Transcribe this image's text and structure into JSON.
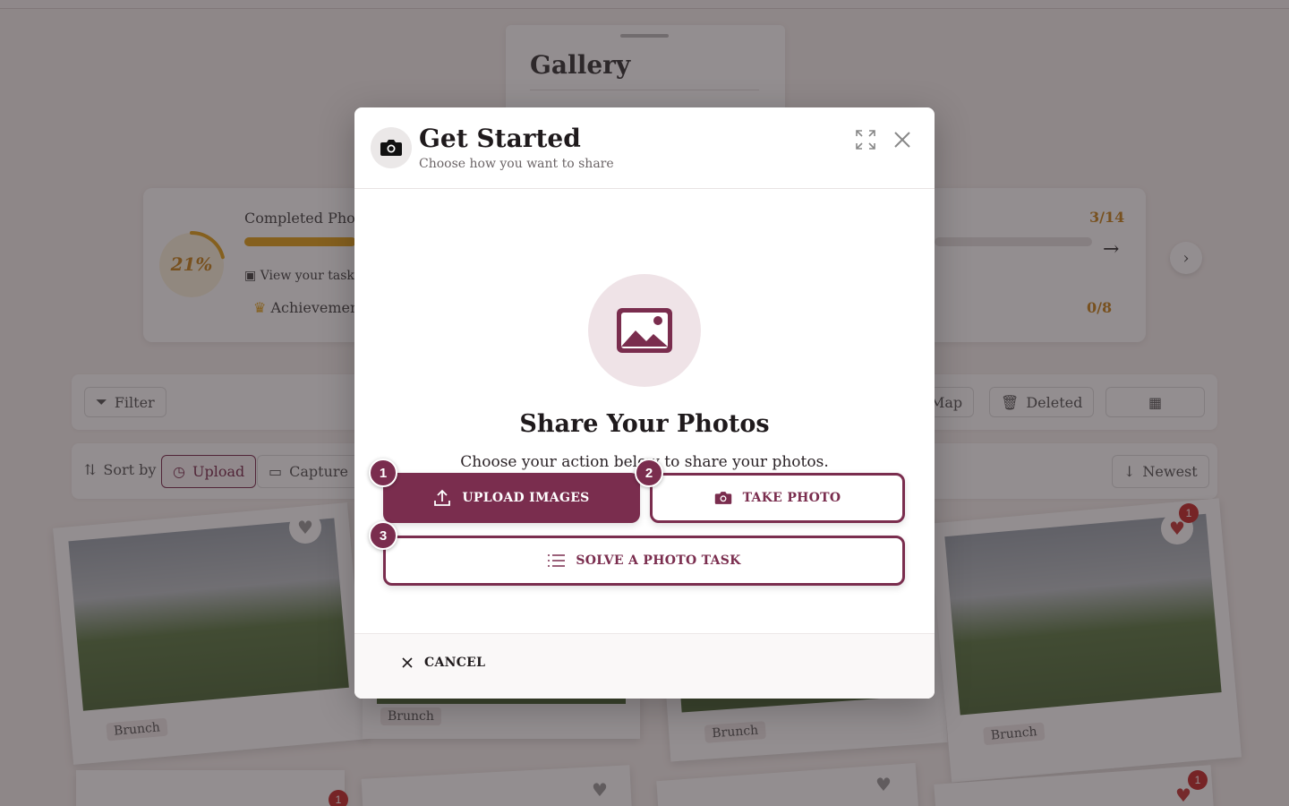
{
  "gallery": {
    "title": "Gallery"
  },
  "progress": {
    "percent_label": "21%",
    "percent_value": 0.21,
    "title": "Completed Photo",
    "link_text": "View your task p",
    "achievements_text": "Achievemen",
    "count_tasks": "3/14",
    "count_achievements": "0/8",
    "tasks_progress": 0.21
  },
  "toolbar": {
    "filter_label": "Filter",
    "map_label": "Map",
    "deleted_label": "Deleted",
    "sort_by_label": "Sort by",
    "upload_label": "Upload",
    "capture_label": "Capture",
    "newest_label": "Newest"
  },
  "photos": [
    {
      "tag": "Brunch",
      "likes": ""
    },
    {
      "tag": "Brunch",
      "likes": ""
    },
    {
      "tag": "Brunch",
      "likes": ""
    },
    {
      "tag": "Brunch",
      "likes": "1"
    }
  ],
  "bottom_badges": [
    "1",
    "1"
  ],
  "modal": {
    "title": "Get Started",
    "subtitle": "Choose how you want to share",
    "hero_title": "Share Your Photos",
    "hero_desc": "Choose your action below to share your photos.",
    "actions": [
      {
        "step": "1",
        "label": "UPLOAD IMAGES"
      },
      {
        "step": "2",
        "label": "TAKE PHOTO"
      },
      {
        "step": "3",
        "label": "SOLVE A PHOTO TASK"
      }
    ],
    "cancel_label": "CANCEL"
  },
  "colors": {
    "brand": "#7a2d4e",
    "accent": "#e3a21a",
    "badge": "#c42a2a"
  }
}
